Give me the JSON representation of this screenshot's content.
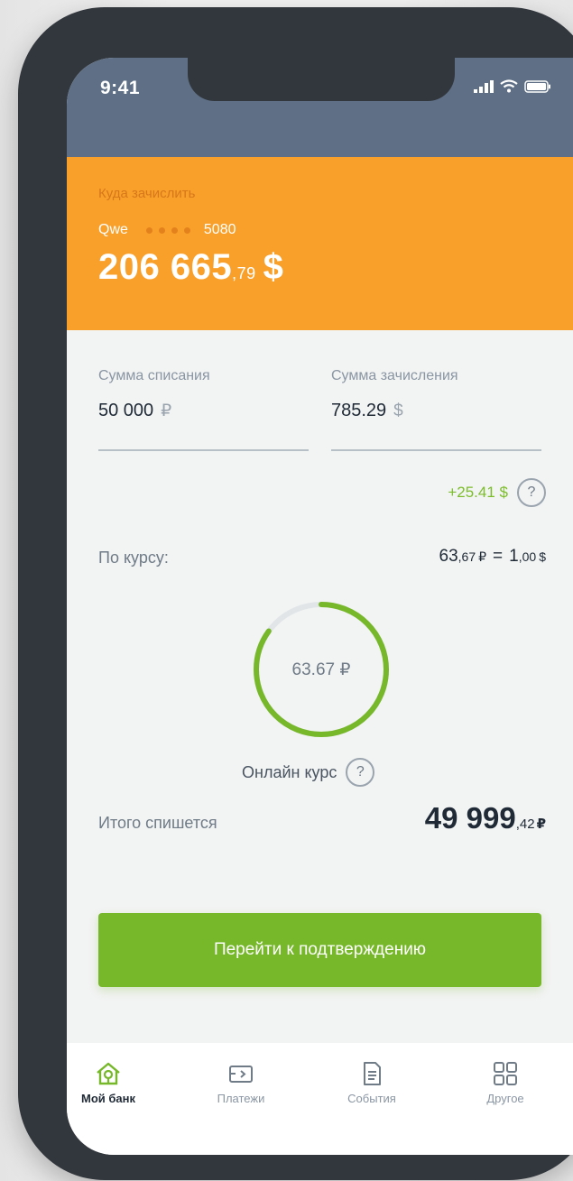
{
  "status_bar": {
    "time": "9:41",
    "icons": [
      "signal-icon",
      "wifi-icon",
      "battery-icon"
    ]
  },
  "destination": {
    "label": "Куда зачислить",
    "card_name": "Qwe",
    "card_last4": "5080",
    "balance_whole": "206 665",
    "balance_cents": ",79",
    "balance_currency": "$"
  },
  "debit": {
    "label": "Сумма списания",
    "value": "50 000",
    "currency": "₽"
  },
  "credit": {
    "label": "Сумма зачисления",
    "value": "785.29",
    "currency": "$"
  },
  "bonus": {
    "text": "+25.41 $",
    "help_icon": "?"
  },
  "rate": {
    "label": "По курсу:",
    "left_whole": "63",
    "left_cents": ",67",
    "left_currency": "₽",
    "equals": "=",
    "right_whole": "1",
    "right_cents": ",00",
    "right_currency": "$"
  },
  "online_rate": {
    "ring_value": "63.67 ₽",
    "ring_progress": 0.85,
    "label": "Онлайн курс",
    "help_icon": "?"
  },
  "total": {
    "label": "Итого спишется",
    "whole": "49 999",
    "cents": ",42",
    "currency": "₽"
  },
  "cta": {
    "label": "Перейти к подтверждению"
  },
  "tabs": [
    {
      "label": "Мой банк",
      "icon": "home-icon",
      "active": true
    },
    {
      "label": "Платежи",
      "icon": "payments-icon",
      "active": false
    },
    {
      "label": "События",
      "icon": "document-icon",
      "active": false
    },
    {
      "label": "Другое",
      "icon": "grid-icon",
      "active": false
    }
  ],
  "colors": {
    "accent_orange": "#f9a02b",
    "accent_green": "#76b82a",
    "status_bar": "#5f7086",
    "text_dark": "#1f2a36",
    "text_muted": "#8a96a3"
  }
}
